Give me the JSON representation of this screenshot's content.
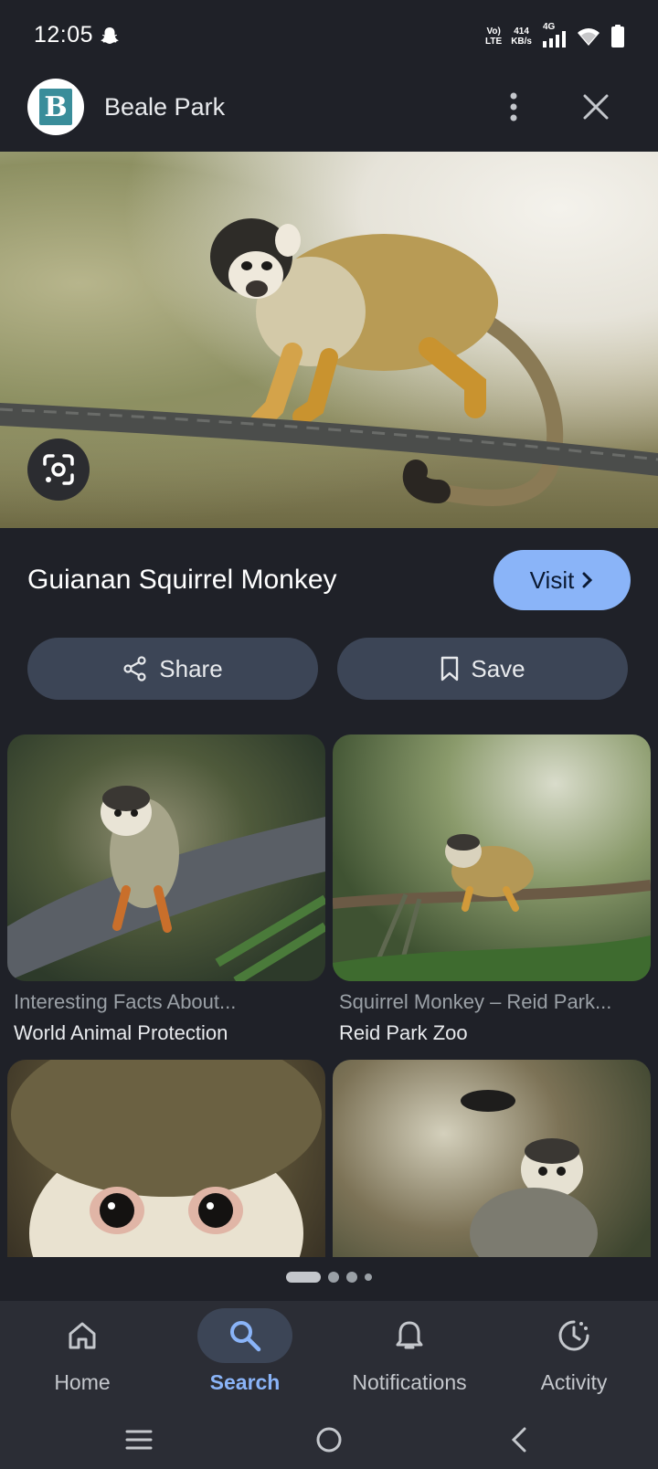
{
  "status_bar": {
    "time": "12:05",
    "volte_top": "Vo)",
    "volte_bottom": "LTE",
    "speed_value": "414",
    "speed_unit": "KB/s",
    "network": "4G"
  },
  "header": {
    "site_logo_letter": "B",
    "site_name": "Beale Park"
  },
  "result": {
    "title": "Guianan Squirrel Monkey",
    "visit_label": "Visit"
  },
  "actions": {
    "share_label": "Share",
    "save_label": "Save"
  },
  "related": [
    {
      "source_title": "Interesting Facts About...",
      "site": "World Animal Protection"
    },
    {
      "source_title": "Squirrel Monkey – Reid Park...",
      "site": "Reid Park Zoo"
    },
    {
      "source_title": "",
      "site": ""
    },
    {
      "source_title": "",
      "site": ""
    }
  ],
  "bottom_nav": {
    "items": [
      {
        "label": "Home",
        "icon": "home-icon"
      },
      {
        "label": "Search",
        "icon": "search-icon",
        "active": true
      },
      {
        "label": "Notifications",
        "icon": "bell-icon"
      },
      {
        "label": "Activity",
        "icon": "activity-icon"
      }
    ]
  },
  "colors": {
    "background": "#1f2128",
    "accent": "#8ab4f8",
    "pill": "#3c4556",
    "nav_bar": "#2b2d35"
  }
}
